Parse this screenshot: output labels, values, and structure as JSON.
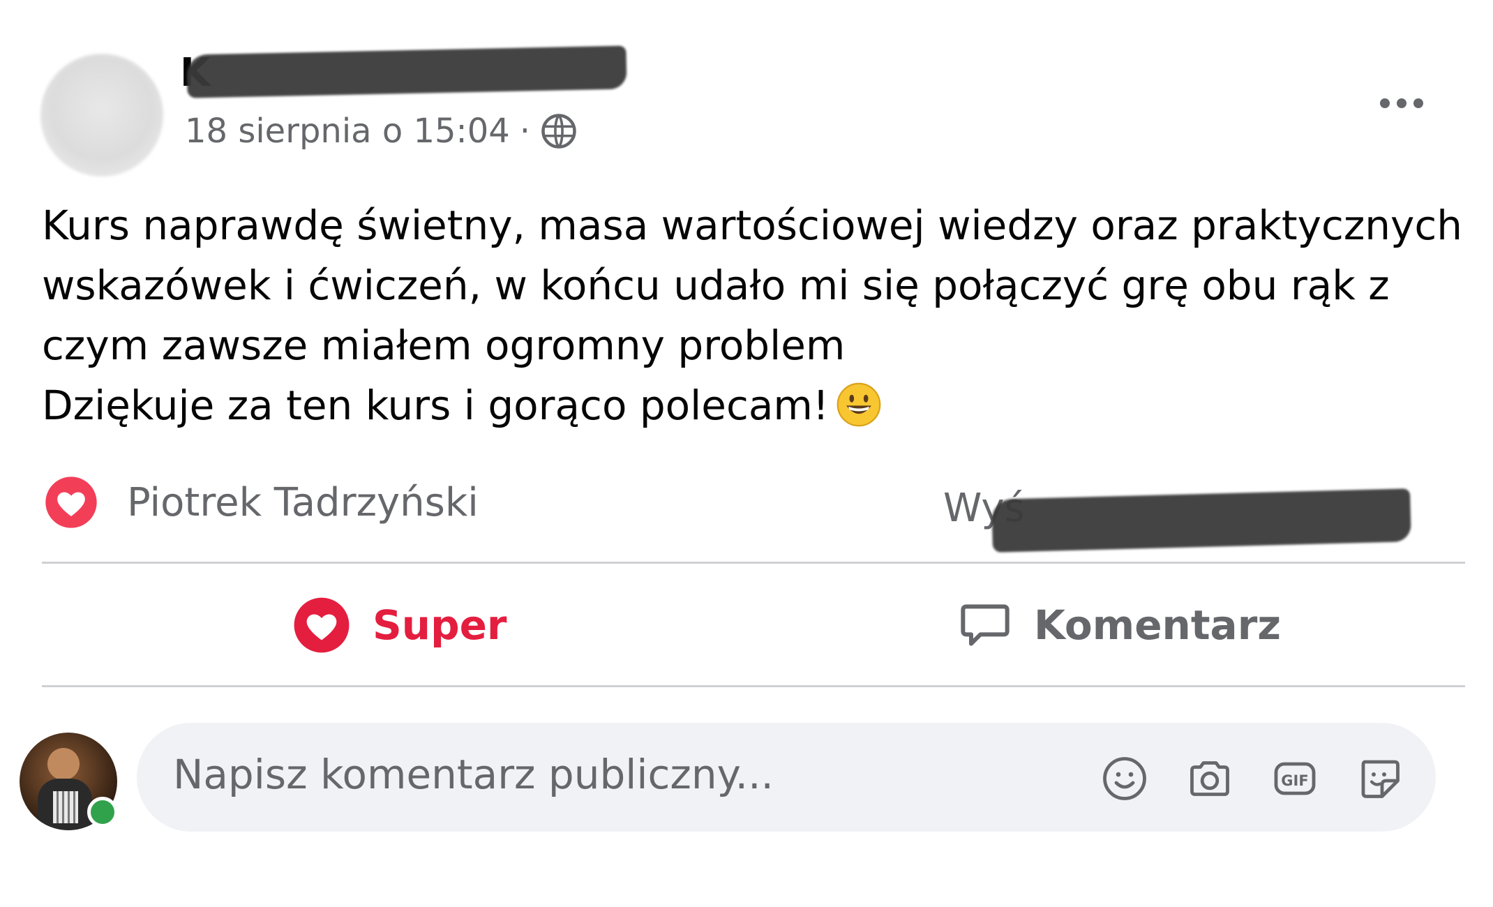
{
  "post": {
    "author_name": "K",
    "date": "18 sierpnia o 15:04",
    "separator": "·",
    "body_lines": [
      "Kurs naprawdę świetny, masa wartościowej wiedzy oraz praktycznych",
      "wskazówek i ćwiczeń, w końcu udało mi się połączyć grę obu rąk z",
      "czym zawsze miałem ogromny problem",
      "Dziękuje za ten kurs i gorąco polecam!"
    ]
  },
  "reactions": {
    "reactor_name": "Piotrek Tadrzyński",
    "views_text": "Wyś"
  },
  "actions": {
    "super_label": "Super",
    "comment_label": "Komentarz"
  },
  "composer": {
    "placeholder": "Napisz komentarz publiczny..."
  },
  "colors": {
    "love_red": "#e41e3f",
    "secondary_text": "#65676b",
    "online_green": "#31a24c",
    "composer_bg": "#f0f2f5"
  },
  "icons": [
    "more-icon",
    "globe-icon",
    "heart-icon",
    "comment-icon",
    "emoji-icon",
    "camera-icon",
    "gif-icon",
    "sticker-icon"
  ]
}
